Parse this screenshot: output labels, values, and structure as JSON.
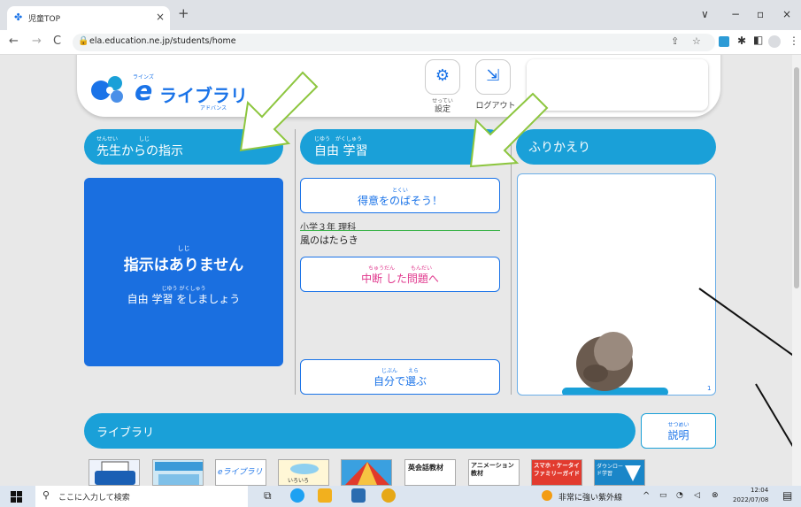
{
  "browser": {
    "tab_title": "児童TOP",
    "url": "ela.education.ne.jp/students/home",
    "new_tab": "+",
    "tab_close": "×",
    "controls": {
      "dropdown": "∨",
      "minimize": "−",
      "restore": "▫",
      "close": "×"
    },
    "nav": {
      "back": "←",
      "forward": "→",
      "reload": "C"
    }
  },
  "header": {
    "logo_ruby": "ラインズ",
    "logo_e": "e",
    "logo_text": "ライブラリ",
    "logo_sub": "アドバンス",
    "settings_ruby": "せってい",
    "settings_label": "設定",
    "logout_label": "ログアウト"
  },
  "sections": {
    "teacher": {
      "ruby": "せんせい　　　　しじ",
      "title": "先生からの指示"
    },
    "free": {
      "ruby": "じゆう　がくしゅう",
      "title": "自由 学習"
    },
    "review": {
      "title": "ふりかえり"
    }
  },
  "teacher_box": {
    "ruby1": "しじ",
    "main": "指示はありません",
    "ruby2": "じゆう がくしゅう",
    "sub": "自由 学習 をしましょう"
  },
  "free_study": {
    "strength_ruby": "とくい",
    "strength_label": "得意をのばそう！",
    "grade_subject": "小学３年 理科",
    "unit": "風のはたらき",
    "resume_ruby": "ちゅうだん　　　もんだい",
    "resume_label": "中断 した問題へ",
    "choose_ruby": "じぶん　　えら",
    "choose_label": "自分で選ぶ"
  },
  "review": {
    "page": "1"
  },
  "library": {
    "title": "ライブラリ",
    "explain_ruby": "せつめい",
    "explain_label": "説明",
    "items": [
      "",
      "",
      "eライブラリ",
      "いろいろ",
      "",
      "英会話教材",
      "アニメーション教材",
      "スマホ・ケータイ ファミリーガイド",
      "ダウンロード学習"
    ]
  },
  "taskbar": {
    "search_placeholder": "ここに入力して検索",
    "weather": "非常に強い紫外線",
    "time": "12:04",
    "date": "2022/07/08"
  },
  "colors": {
    "accent": "#1aa0d8",
    "primary": "#1a73e8",
    "teacher_box": "#1a6fe0",
    "resume_text": "#e0368c",
    "arrow_green": "#8dc63f"
  }
}
